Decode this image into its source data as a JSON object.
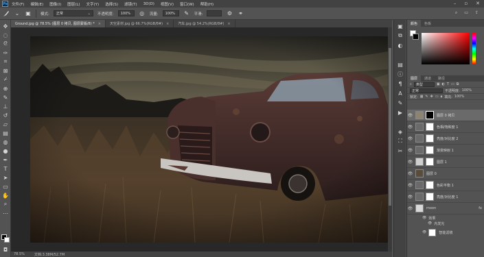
{
  "menubar": {
    "app_logo": "Ps",
    "items": [
      "文件(F)",
      "编辑(E)",
      "图像(I)",
      "图层(L)",
      "文字(Y)",
      "选择(S)",
      "滤镜(T)",
      "3D(D)",
      "视图(V)",
      "窗口(W)",
      "帮助(H)"
    ]
  },
  "options": {
    "mode_label": "模式:",
    "mode_value": "正常",
    "opacity_label": "不透明度:",
    "opacity_value": "100%",
    "flow_label": "流量:",
    "flow_value": "100%",
    "smooth_label": "平滑:"
  },
  "tabs": [
    {
      "label": "Ground.jpg @ 78.5% (图层 0 拷贝, 图层蒙版/8) *",
      "active": true
    },
    {
      "label": "天空素材.jpg @ 66.7%(RGB/8#)",
      "active": false
    },
    {
      "label": "汽车.jpg @ 54.2%(RGB/8#)",
      "active": false
    }
  ],
  "status": {
    "zoom": "78.5%",
    "doc_info": "文档:3.38M/52.7M"
  },
  "panels": {
    "color_tabs": [
      "颜色",
      "色板"
    ],
    "layer_tabs": [
      "图层",
      "通道",
      "路径"
    ],
    "kind_label": "类型",
    "blend_mode": "正常",
    "opacity_label": "不透明度:",
    "opacity_value": "100%",
    "lock_label": "锁定:",
    "fill_label": "填充:",
    "fill_value": "100%"
  },
  "layers": [
    {
      "name": "图层 0 拷贝",
      "selected": true
    },
    {
      "name": "色相/饱和度 1",
      "selected": false
    },
    {
      "name": "亮度/对比度 2",
      "selected": false
    },
    {
      "name": "渐变映射 1",
      "selected": false
    },
    {
      "name": "图层 1",
      "selected": false
    },
    {
      "name": "图层 0",
      "selected": false
    },
    {
      "name": "色彩平衡 1",
      "selected": false
    },
    {
      "name": "亮度/对比度 1",
      "selected": false
    },
    {
      "name": "moon",
      "selected": false
    }
  ],
  "moon_sub": {
    "effects_label": "效果",
    "outer_glow_label": "内发光",
    "smart_filter_label": "智能滤镜"
  },
  "colors": {
    "accent": "#31a8ff",
    "panel": "#535353",
    "dark": "#424242"
  }
}
